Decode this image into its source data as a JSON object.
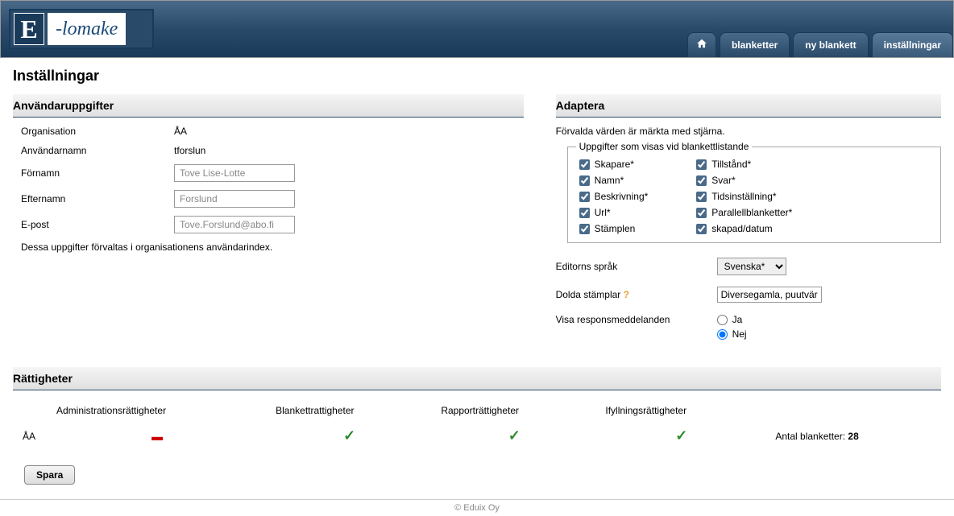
{
  "logo": {
    "letter": "E",
    "text": "-lomake"
  },
  "nav": {
    "home": "⌂",
    "blanketter": "blanketter",
    "ny_blankett": "ny blankett",
    "installningar": "inställningar"
  },
  "page_title": "Inställningar",
  "user_section": {
    "title": "Användaruppgifter",
    "organisation_label": "Organisation",
    "organisation_value": "ÅA",
    "username_label": "Användarnamn",
    "username_value": "tforslun",
    "firstname_label": "Förnamn",
    "firstname_value": "Tove Lise-Lotte",
    "lastname_label": "Efternamn",
    "lastname_value": "Forslund",
    "email_label": "E-post",
    "email_value": "Tove.Forslund@abo.fi",
    "note": "Dessa uppgifter förvaltas i organisationens användarindex."
  },
  "adapt_section": {
    "title": "Adaptera",
    "note": "Förvalda värden är märkta med stjärna.",
    "fieldset_legend": "Uppgifter som visas vid blankettlistande",
    "checkboxes": {
      "col1": [
        "Skapare*",
        "Namn*",
        "Beskrivning*",
        "Url*",
        "Stämplen"
      ],
      "col2": [
        "Tillstånd*",
        "Svar*",
        "Tidsinställning*",
        "Parallellblanketter*",
        "skapad/datum"
      ]
    },
    "editor_lang_label": "Editorns språk",
    "editor_lang_value": "Svenska*",
    "hidden_stamps_label": "Dolda stämplar",
    "hidden_stamps_help": "?",
    "hidden_stamps_value": "Diversegamla, puutvär",
    "show_response_label": "Visa responsmeddelanden",
    "radio_yes": "Ja",
    "radio_no": "Nej"
  },
  "rights_section": {
    "title": "Rättigheter",
    "headers": {
      "org": "",
      "admin": "Administrationsrättigheter",
      "blankett": "Blankettrattigheter",
      "rapport": "Rapporträttigheter",
      "ifyllning": "Ifyllningsrättigheter",
      "count_label": "Antal blanketter:",
      "count_value": "28"
    },
    "row_org": "ÅA"
  },
  "save_button": "Spara",
  "footer": "© Eduix Oy"
}
